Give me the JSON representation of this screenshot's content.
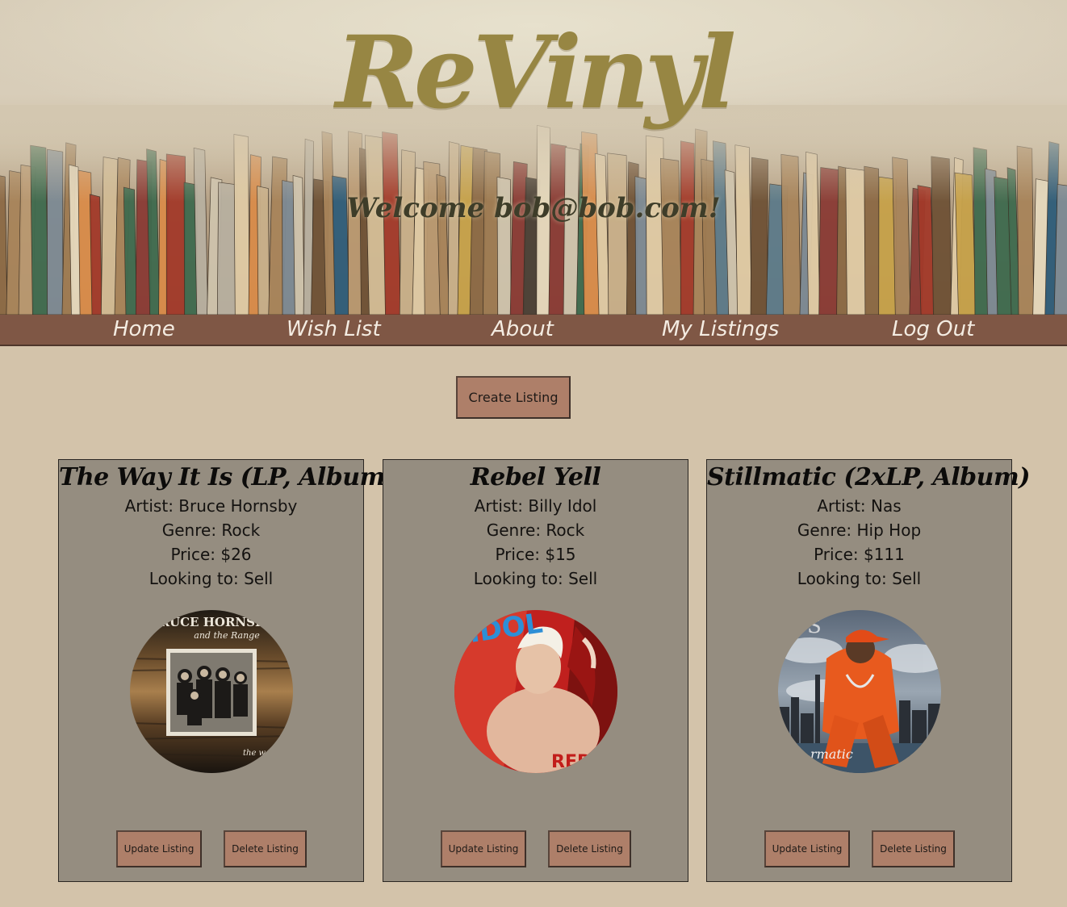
{
  "header": {
    "logo": "ReVinyl",
    "welcome": "Welcome bob@bob.com!"
  },
  "nav": {
    "items": [
      "Home",
      "Wish List",
      "About",
      "My Listings",
      "Log Out"
    ]
  },
  "actions": {
    "create_label": "Create Listing"
  },
  "listings": [
    {
      "title": "The Way It Is (LP, Album)",
      "artist_label": "Artist: ",
      "artist": "Bruce Hornsby",
      "genre_label": "Genre: ",
      "genre": "Rock",
      "price_label": "Price: ",
      "price": "$26",
      "looking_label": "Looking to: ",
      "looking": "Sell",
      "cover_text_1": "BRUCE HORNSBY",
      "cover_text_2": "and the Range",
      "cover_text_3": "the wa",
      "update_label": "Update Listing",
      "delete_label": "Delete Listing"
    },
    {
      "title": "Rebel Yell",
      "artist_label": "Artist: ",
      "artist": "Billy Idol",
      "genre_label": "Genre: ",
      "genre": "Rock",
      "price_label": "Price: ",
      "price": "$15",
      "looking_label": "Looking to: ",
      "looking": "Sell",
      "cover_text_1": "IDOL",
      "cover_text_2": "REBEL",
      "update_label": "Update Listing",
      "delete_label": "Delete Listing"
    },
    {
      "title": "Stillmatic (2xLP, Album)",
      "artist_label": "Artist: ",
      "artist": "Nas",
      "genre_label": "Genre: ",
      "genre": "Hip Hop",
      "price_label": "Price: ",
      "price": "$111",
      "looking_label": "Looking to: ",
      "looking": "Sell",
      "cover_text_1": "rmatic",
      "update_label": "Update Listing",
      "delete_label": "Delete Listing"
    }
  ],
  "colors": {
    "background": "#d3c3aa",
    "nav": "#7f5745",
    "button": "#ae7f69",
    "card": "#958d80",
    "logo": "#978643"
  }
}
